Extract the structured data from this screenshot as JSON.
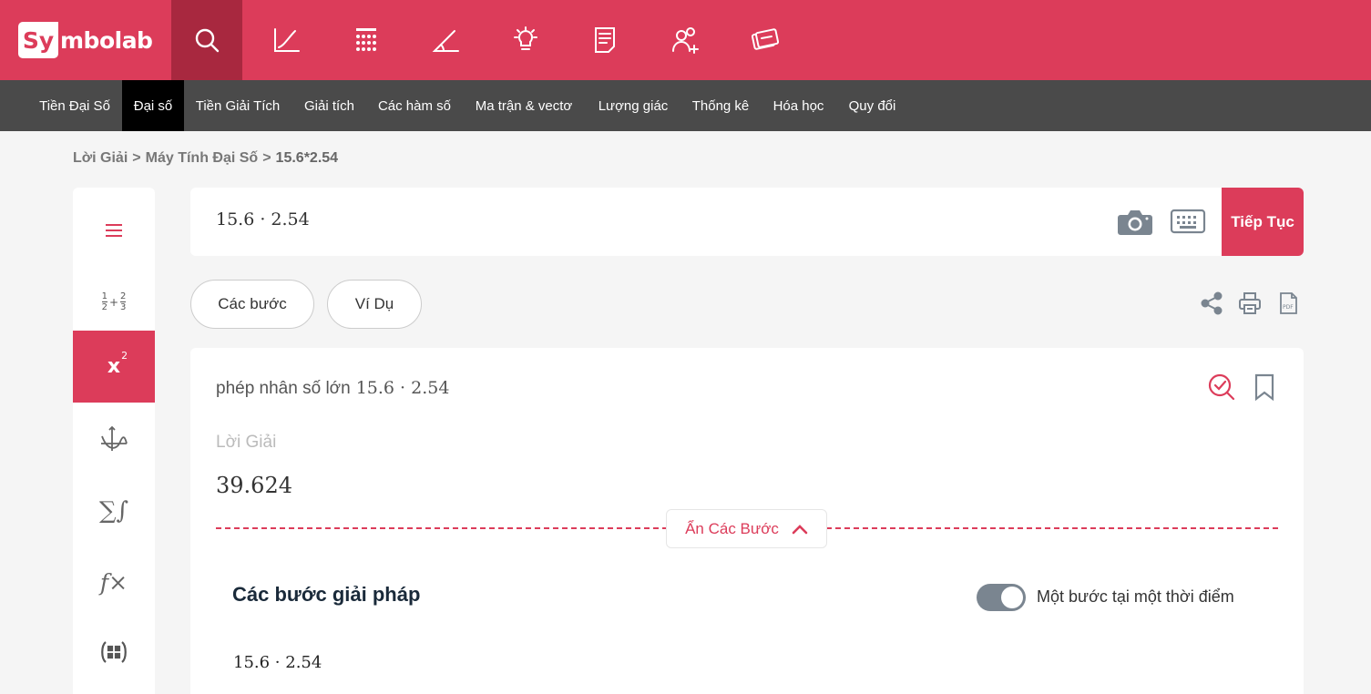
{
  "brand": {
    "logo_left": "Sy",
    "logo_right": "mbolab",
    "accent": "#dc3c5a",
    "accent_dark": "#a8283f"
  },
  "top_icons": [
    {
      "name": "search-icon",
      "active": true
    },
    {
      "name": "graph-icon",
      "active": false
    },
    {
      "name": "calculator-icon",
      "active": false
    },
    {
      "name": "geometry-icon",
      "active": false
    },
    {
      "name": "lightbulb-icon",
      "active": false
    },
    {
      "name": "notebook-icon",
      "active": false
    },
    {
      "name": "group-icon",
      "active": false
    },
    {
      "name": "practice-icon",
      "active": false
    }
  ],
  "subnav": {
    "items": [
      "Tiền Đại Số",
      "Đại số",
      "Tiền Giải Tích",
      "Giải tích",
      "Các hàm số",
      "Ma trận & vectơ",
      "Lượng giác",
      "Thống kê",
      "Hóa học",
      "Quy đổi"
    ],
    "active_index": 1
  },
  "breadcrumb": {
    "part1": "Lời Giải",
    "sep1": ">",
    "part2": "Máy Tính Đại Số",
    "sep2": ">",
    "part3": "15.6*2.54"
  },
  "sidebar": {
    "icons": [
      "menu-icon",
      "fraction-icon",
      "exponent-icon",
      "function-graph-icon",
      "sum-integral-icon",
      "function-icon",
      "matrix-icon"
    ],
    "active_index": 2,
    "fraction_glyph": {
      "a": "1",
      "b": "2",
      "c": "2",
      "d": "3"
    },
    "exponent_glyph": {
      "base": "x",
      "sup": "2"
    },
    "fx_glyph": "f×",
    "sum_glyph": "∑∫"
  },
  "input": {
    "expression": "15.6 · 2.54",
    "go_label": "Tiếp Tục"
  },
  "tabs": {
    "steps_label": "Các bước",
    "examples_label": "Ví Dụ"
  },
  "card": {
    "title_text": "phép nhân số lớn",
    "title_math": "15.6 · 2.54",
    "solution_label": "Lời Giải",
    "solution_value": "39.624",
    "hide_steps_label": "Ẩn Các Bước",
    "steps_title": "Các bước giải pháp",
    "toggle_label": "Một bước tại một thời điểm",
    "toggle_on": true,
    "step_expr": "15.6 · 2.54"
  }
}
